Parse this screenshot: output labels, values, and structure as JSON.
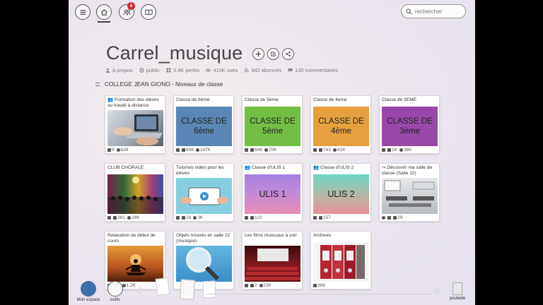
{
  "topbar": {
    "menu_icon": "menu-icon",
    "home_icon": "home-icon",
    "group_icon": "group-icon",
    "group_badge": "6",
    "book_icon": "book-icon",
    "search_placeholder": "rechercher"
  },
  "header": {
    "title": "Carrel_musique",
    "meta": {
      "about": "à propos",
      "visibility": "public",
      "perles": "5.4K perles",
      "views": "410K vues",
      "subscribers": "342 abonnés",
      "comments": "130 commentaires"
    }
  },
  "section": {
    "label": "COLLEGE JEAN GIONO - Niveaux de classe"
  },
  "cards": [
    {
      "caption": "Formation des élèves au travail à distance",
      "img_text": "",
      "stats": [
        "8",
        "628"
      ]
    },
    {
      "caption": "Classe de 6ème",
      "img_text": "CLASSE DE 6ème",
      "stats": [
        "806",
        "147K"
      ],
      "color": "#5a86b5"
    },
    {
      "caption": "Classe de 5ème",
      "img_text": "CLASSE DE 5ème",
      "stats": [
        "846",
        "70K"
      ],
      "color": "#73be45"
    },
    {
      "caption": "Classe de 4eme",
      "img_text": "CLASSE DE 4ème",
      "stats": [
        "743",
        "41K"
      ],
      "color": "#e7a03f"
    },
    {
      "caption": "Classe de 3EME",
      "img_text": "CLASSE DE 3ème",
      "stats": [
        "1K",
        "36K"
      ],
      "color": "#9848a9"
    },
    {
      "caption": "CLUB CHORALE",
      "img_text": "",
      "stats": [
        "381",
        "24K"
      ]
    },
    {
      "caption": "Tutoriels vidéo pour les élèves",
      "img_text": "",
      "stats": [
        "16",
        "3K"
      ]
    },
    {
      "caption": "Classe d'ULIS 1",
      "img_text": "ULIS 1",
      "stats": [
        "110"
      ]
    },
    {
      "caption": "Classe d'ULIS 2",
      "img_text": "ULIS 2",
      "stats": [
        "157"
      ]
    },
    {
      "caption": "Découvrir ma salle de classe (Salle 22)",
      "img_text": "",
      "stats": [
        "29"
      ]
    },
    {
      "caption": "Relaxation de début de cours",
      "img_text": "",
      "stats": [
        "3",
        "1.2K"
      ]
    },
    {
      "caption": "Objets trouvés en salle 22 (musique)",
      "img_text": "",
      "stats": []
    },
    {
      "caption": "Les films musicaux à voir",
      "img_text": "",
      "stats": [
        "2",
        "230"
      ]
    },
    {
      "caption": "Archives",
      "img_text": "",
      "stats": [
        "386"
      ]
    }
  ],
  "dock": {
    "mon_espace": "Mon espace",
    "outils": "outils",
    "poubelle": "poubelle"
  }
}
